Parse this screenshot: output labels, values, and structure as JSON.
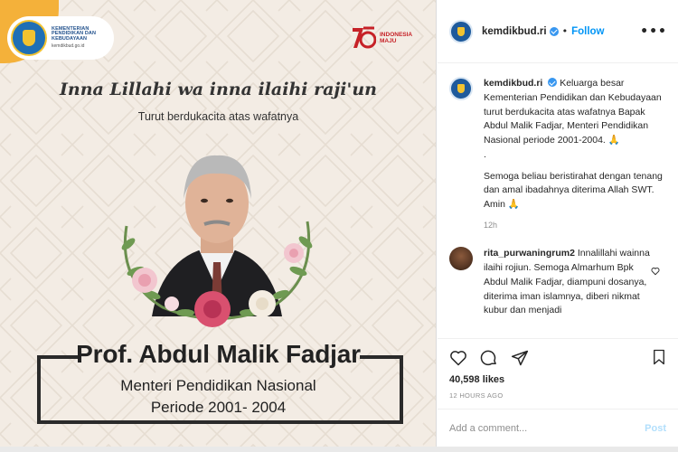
{
  "image": {
    "logo": {
      "line1": "KEMENTERIAN",
      "line2": "PENDIDIKAN DAN",
      "line3": "KEBUDAYAAN",
      "url": "kemdikbud.go.id"
    },
    "ri_logo": {
      "line1": "INDONESIA",
      "line2": "MAJU"
    },
    "headline": "Inna Lillahi wa inna ilaihi raji'un",
    "subline": "Turut berdukacita atas wafatnya",
    "name": "Prof. Abdul Malik Fadjar",
    "role": "Menteri Pendidikan Nasional",
    "period": "Periode 2001- 2004",
    "colors": {
      "accent": "#f4b13a",
      "background": "#f3ece4"
    }
  },
  "header": {
    "username": "kemdikbud.ri",
    "separator": "•",
    "follow_label": "Follow",
    "more_icon": "•••"
  },
  "caption": {
    "username": "kemdikbud.ri",
    "text1": "Keluarga besar Kementerian Pendidikan dan Kebudayaan turut berdukacita atas wafatnya Bapak Abdul Malik Fadjar, Menteri Pendidikan Nasional periode 2001-2004. 🙏",
    "text2": ".",
    "text3": "Semoga beliau beristirahat dengan tenang dan amal ibadahnya diterima Allah SWT. Amin 🙏",
    "time": "12h"
  },
  "comment": {
    "username": "rita_purwaningrum2",
    "text": "Innalillahi wainna ilaihi rojiun. Semoga Almarhum Bpk Abdul Malik Fadjar, diampuni dosanya, diterima iman islamnya, diberi nikmat kubur dan menjadi"
  },
  "actions": {
    "likes": "40,598 likes",
    "age": "12 HOURS AGO"
  },
  "add_comment": {
    "placeholder": "Add a comment...",
    "post_label": "Post"
  },
  "colors": {
    "link": "#0095f6",
    "verified": "#3897f0",
    "text": "#262626",
    "muted": "#8e8e8e"
  }
}
